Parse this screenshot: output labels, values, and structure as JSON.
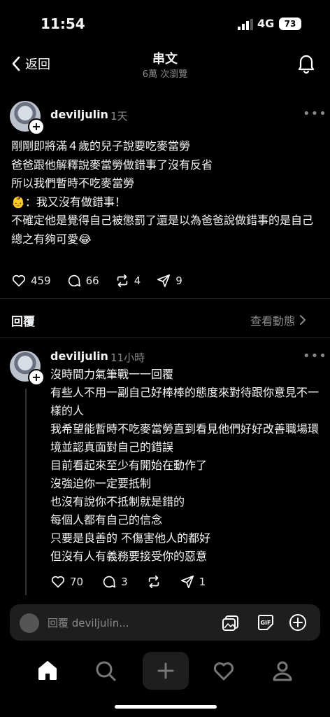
{
  "status": {
    "time": "11:54",
    "network": "4G",
    "battery": "73"
  },
  "header": {
    "back_label": "返回",
    "title": "串文",
    "subtitle": "6萬 次瀏覽"
  },
  "post": {
    "username": "deviljulin",
    "time": "1天",
    "more": "•••",
    "lines": [
      "剛剛即將滿４歲的兒子說要吃麥當勞",
      "爸爸跟他解釋說麥當勞做錯事了沒有反省",
      "所以我們暫時不吃麥當勞",
      "👶：我又沒有做錯事！",
      "不確定他是覺得自己被懲罰了還是以為爸爸說做錯事的是自己",
      "總之有夠可愛😂"
    ],
    "likes": "459",
    "comments": "66",
    "reposts": "4",
    "shares": "9"
  },
  "replies_section": {
    "label": "回覆",
    "activity_label": "查看動態"
  },
  "reply": {
    "username": "deviljulin",
    "time": "11小時",
    "more": "•••",
    "lines": [
      "沒時間力氣筆戰一一回覆",
      "有些人不用一副自己好棒棒的態度來對待跟你意見不一樣的人",
      "我希望能暫時不吃麥當勞直到看見他們好好改善職場環境並認真面對自己的錯誤",
      "目前看起來至少有開始在動作了",
      "沒強迫你一定要抵制",
      "也沒有說你不抵制就是錯的",
      "每個人都有自己的信念",
      "只要是良善的 不傷害他人的都好",
      "但沒有人有義務要接受你的惡意"
    ],
    "likes": "70",
    "comments": "3",
    "shares": "1"
  },
  "reply_bar": {
    "placeholder": "回覆 deviljulin..."
  },
  "icons": {
    "back": "chevron-left-icon",
    "bell": "bell-icon",
    "heart": "heart-icon",
    "comment": "comment-icon",
    "repost": "repost-icon",
    "share": "send-icon",
    "image": "image-icon",
    "gif": "gif-icon",
    "add": "plus-circle-icon",
    "home": "home-icon",
    "search": "search-icon",
    "create": "plus-icon",
    "activity": "heart-icon",
    "profile": "profile-icon"
  }
}
